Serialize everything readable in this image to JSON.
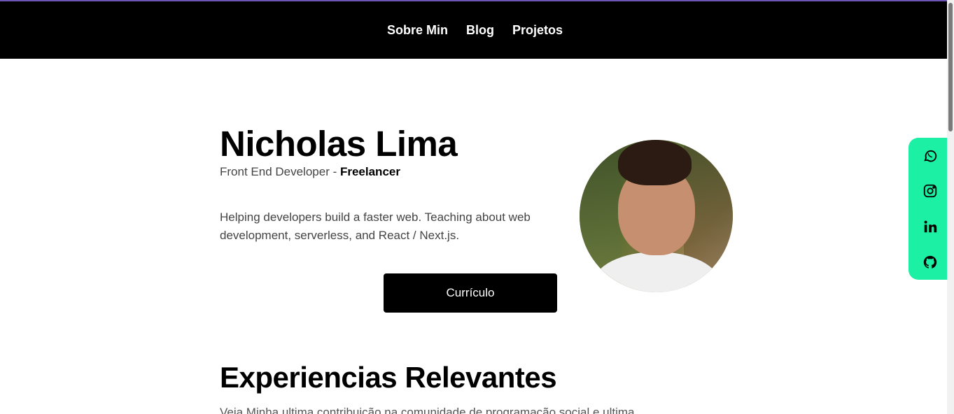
{
  "nav": {
    "items": [
      "Sobre Min",
      "Blog",
      "Projetos"
    ]
  },
  "hero": {
    "name": "Nicholas Lima",
    "role_prefix": "Front End Developer - ",
    "role_highlight": "Freelancer",
    "description": "Helping developers build a faster web. Teaching about web development, serverless, and React / Next.js.",
    "cv_button": "Currículo"
  },
  "social": {
    "icons": [
      "whatsapp-icon",
      "instagram-icon",
      "linkedin-icon",
      "github-icon"
    ],
    "background_color": "#1cf0a4"
  },
  "experience": {
    "title": "Experiencias Relevantes",
    "partial_text": "Veja Minha ultima contribuição na comunidade de programação social e ultima"
  },
  "colors": {
    "nav_background": "#000000",
    "accent_line": "#6d55b8"
  }
}
